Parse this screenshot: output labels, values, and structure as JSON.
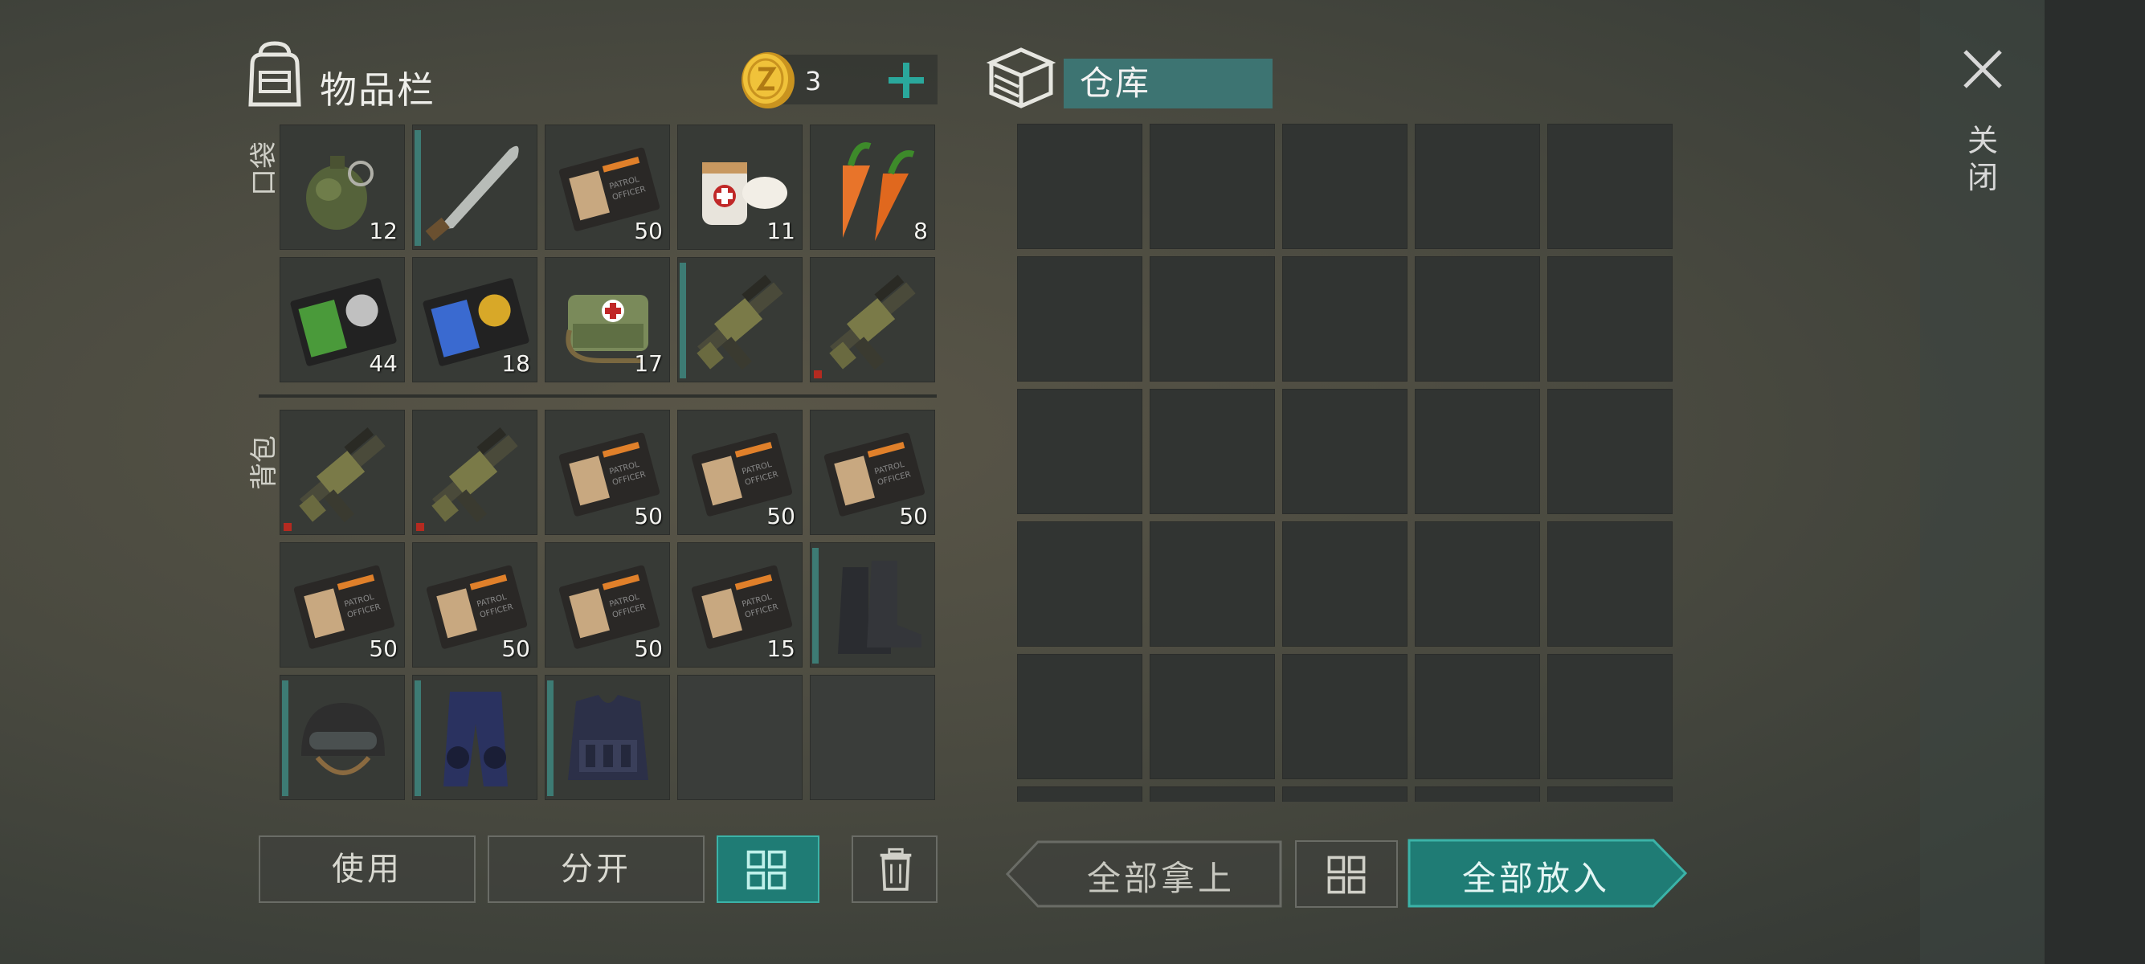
{
  "inventory": {
    "title": "物品栏",
    "coins": "3",
    "pocket_label": "口袋",
    "backpack_label": "背包",
    "pocket_slots": [
      {
        "item": "grenade-icon",
        "qty": "12",
        "bar": false,
        "red": false
      },
      {
        "item": "machete-icon",
        "qty": "",
        "bar": true,
        "red": false
      },
      {
        "item": "id-card-icon",
        "qty": "50",
        "bar": false,
        "red": false
      },
      {
        "item": "bandage-icon",
        "qty": "11",
        "bar": false,
        "red": false
      },
      {
        "item": "carrots-icon",
        "qty": "8",
        "bar": false,
        "red": false
      },
      {
        "item": "badge-wallet-green-icon",
        "qty": "44",
        "bar": false,
        "red": false
      },
      {
        "item": "badge-wallet-blue-icon",
        "qty": "18",
        "bar": false,
        "red": false
      },
      {
        "item": "medkit-bag-icon",
        "qty": "17",
        "bar": false,
        "red": false
      },
      {
        "item": "rifle-icon",
        "qty": "",
        "bar": true,
        "red": false
      },
      {
        "item": "rifle-icon",
        "qty": "",
        "bar": false,
        "red": true
      }
    ],
    "backpack_slots": [
      {
        "item": "rifle-icon",
        "qty": "",
        "bar": false,
        "red": true
      },
      {
        "item": "rifle-icon",
        "qty": "",
        "bar": false,
        "red": true
      },
      {
        "item": "id-card-icon",
        "qty": "50",
        "bar": false,
        "red": false
      },
      {
        "item": "id-card-icon",
        "qty": "50",
        "bar": false,
        "red": false
      },
      {
        "item": "id-card-icon",
        "qty": "50",
        "bar": false,
        "red": false
      },
      {
        "item": "id-card-icon",
        "qty": "50",
        "bar": false,
        "red": false
      },
      {
        "item": "id-card-icon",
        "qty": "50",
        "bar": false,
        "red": false
      },
      {
        "item": "id-card-icon",
        "qty": "50",
        "bar": false,
        "red": false
      },
      {
        "item": "id-card-icon",
        "qty": "15",
        "bar": false,
        "red": false
      },
      {
        "item": "boots-icon",
        "qty": "",
        "bar": true,
        "red": false
      },
      {
        "item": "helmet-icon",
        "qty": "",
        "bar": true,
        "red": false
      },
      {
        "item": "pants-icon",
        "qty": "",
        "bar": true,
        "red": false
      },
      {
        "item": "vest-icon",
        "qty": "",
        "bar": true,
        "red": false
      },
      {
        "item": "",
        "qty": "",
        "bar": false,
        "red": false
      },
      {
        "item": "",
        "qty": "",
        "bar": false,
        "red": false
      }
    ]
  },
  "warehouse": {
    "title": "仓库",
    "slot_count": 30
  },
  "buttons": {
    "use": "使用",
    "split": "分开",
    "take_all": "全部拿上",
    "put_all": "全部放入"
  },
  "close_label": "关闭",
  "colors": {
    "accent": "#1f7c75",
    "slot_bar": "#3d7b74",
    "durability_red": "#b42a20"
  }
}
